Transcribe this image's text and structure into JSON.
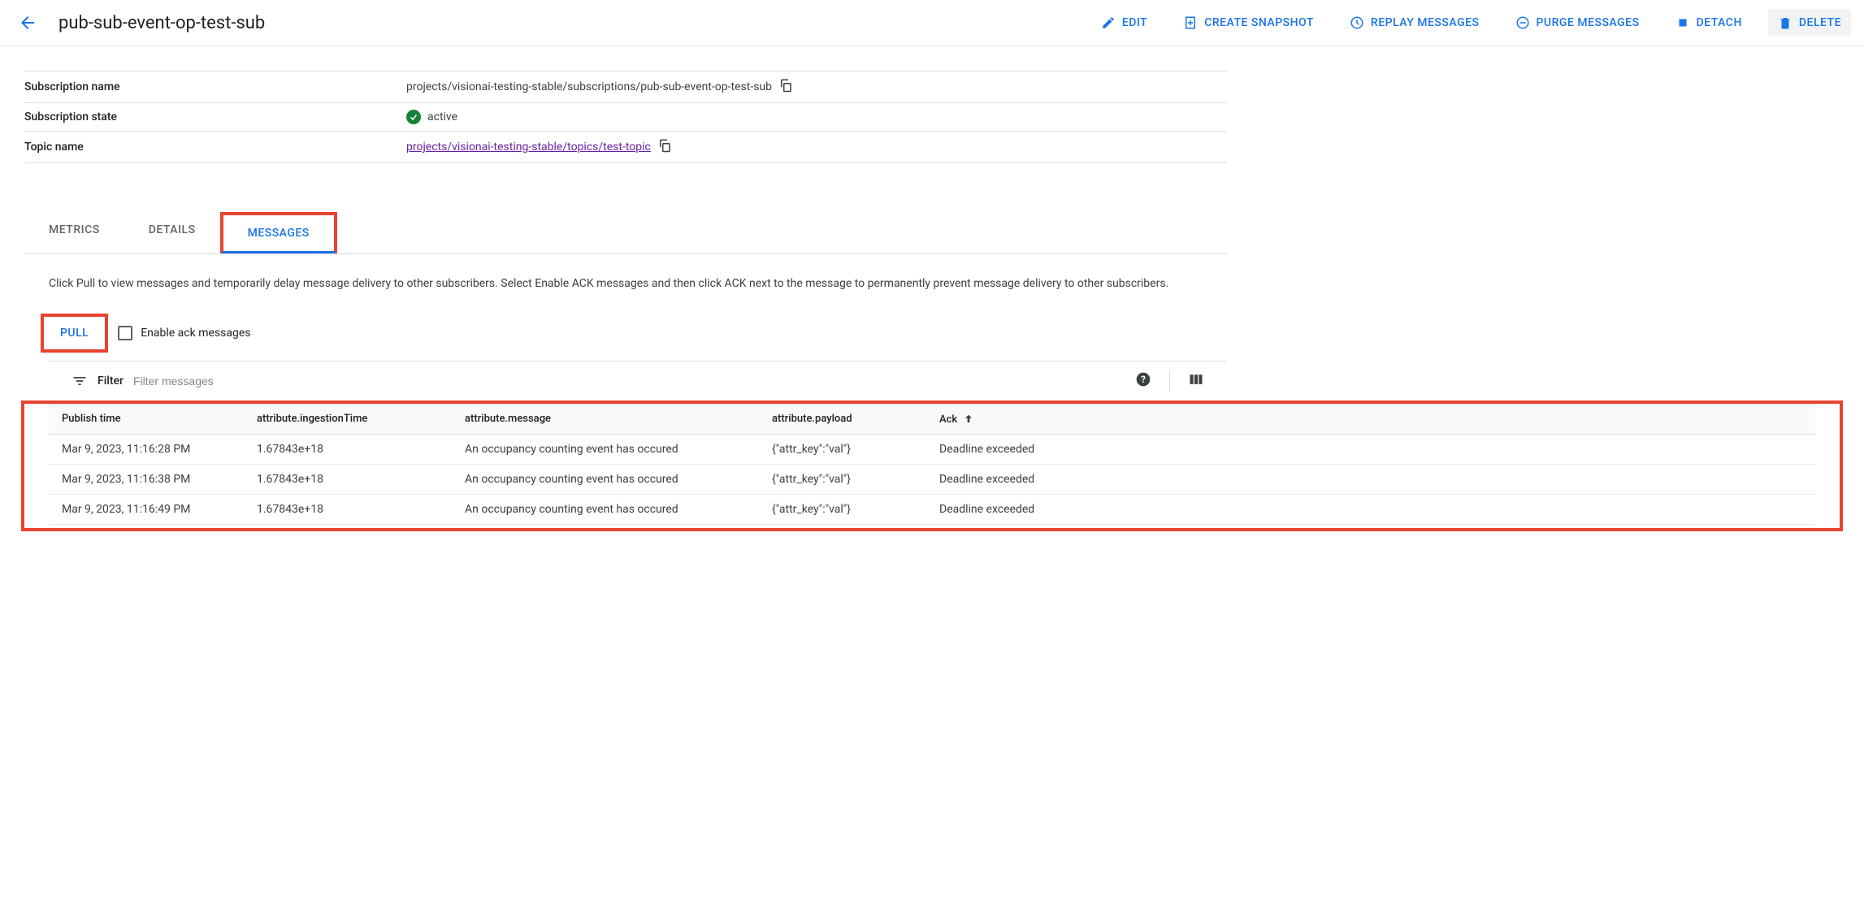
{
  "header": {
    "title": "pub-sub-event-op-test-sub",
    "actions": {
      "edit": "EDIT",
      "snapshot": "CREATE SNAPSHOT",
      "replay": "REPLAY MESSAGES",
      "purge": "PURGE MESSAGES",
      "detach": "DETACH",
      "delete": "DELETE"
    }
  },
  "details": {
    "subscription_name_label": "Subscription name",
    "subscription_name_value": "projects/visionai-testing-stable/subscriptions/pub-sub-event-op-test-sub",
    "subscription_state_label": "Subscription state",
    "subscription_state_value": "active",
    "topic_name_label": "Topic name",
    "topic_name_value": "projects/visionai-testing-stable/topics/test-topic"
  },
  "tabs": {
    "metrics": "METRICS",
    "details": "DETAILS",
    "messages": "MESSAGES"
  },
  "messages_panel": {
    "help_text": "Click Pull to view messages and temporarily delay message delivery to other subscribers. Select Enable ACK messages and then click ACK next to the message to permanently prevent message delivery to other subscribers.",
    "pull_label": "PULL",
    "enable_ack_label": "Enable ack messages",
    "filter_label": "Filter",
    "filter_placeholder": "Filter messages"
  },
  "table": {
    "headers": {
      "publish_time": "Publish time",
      "ingestion": "attribute.ingestionTime",
      "message": "attribute.message",
      "payload": "attribute.payload",
      "ack": "Ack"
    },
    "rows": [
      {
        "publish_time": "Mar 9, 2023, 11:16:28 PM",
        "ingestion": "1.67843e+18",
        "message": "An occupancy counting event has occured",
        "payload": "{\"attr_key\":\"val\"}",
        "ack": "Deadline exceeded"
      },
      {
        "publish_time": "Mar 9, 2023, 11:16:38 PM",
        "ingestion": "1.67843e+18",
        "message": "An occupancy counting event has occured",
        "payload": "{\"attr_key\":\"val\"}",
        "ack": "Deadline exceeded"
      },
      {
        "publish_time": "Mar 9, 2023, 11:16:49 PM",
        "ingestion": "1.67843e+18",
        "message": "An occupancy counting event has occured",
        "payload": "{\"attr_key\":\"val\"}",
        "ack": "Deadline exceeded"
      }
    ]
  }
}
